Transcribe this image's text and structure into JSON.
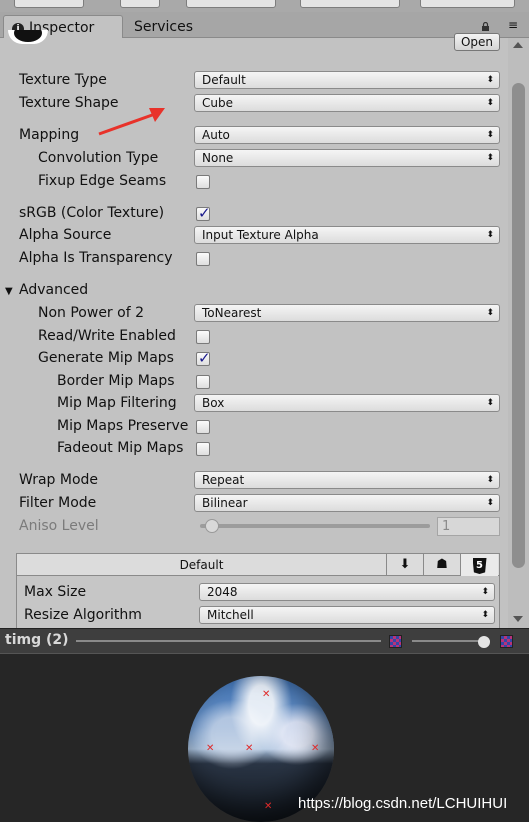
{
  "tabs": {
    "inspector": "Inspector",
    "services": "Services"
  },
  "header": {
    "open_button": "Open"
  },
  "properties": {
    "texture_type": {
      "label": "Texture Type",
      "value": "Default"
    },
    "texture_shape": {
      "label": "Texture Shape",
      "value": "Cube"
    },
    "mapping": {
      "label": "Mapping",
      "value": "Auto"
    },
    "convolution_type": {
      "label": "Convolution Type",
      "value": "None"
    },
    "fixup_edge_seams": {
      "label": "Fixup Edge Seams",
      "checked": false
    },
    "srgb": {
      "label": "sRGB (Color Texture)",
      "checked": true
    },
    "alpha_source": {
      "label": "Alpha Source",
      "value": "Input Texture Alpha"
    },
    "alpha_is_transparency": {
      "label": "Alpha Is Transparency",
      "checked": false
    },
    "advanced": {
      "label": "Advanced",
      "expanded": true
    },
    "non_power_of_2": {
      "label": "Non Power of 2",
      "value": "ToNearest"
    },
    "read_write": {
      "label": "Read/Write Enabled",
      "checked": false
    },
    "generate_mip_maps": {
      "label": "Generate Mip Maps",
      "checked": true
    },
    "border_mip_maps": {
      "label": "Border Mip Maps",
      "checked": false
    },
    "mip_map_filtering": {
      "label": "Mip Map Filtering",
      "value": "Box"
    },
    "mip_maps_preserve": {
      "label": "Mip Maps Preserve",
      "checked": false
    },
    "fadeout_mip_maps": {
      "label": "Fadeout Mip Maps",
      "checked": false
    },
    "wrap_mode": {
      "label": "Wrap Mode",
      "value": "Repeat"
    },
    "filter_mode": {
      "label": "Filter Mode",
      "value": "Bilinear"
    },
    "aniso_level": {
      "label": "Aniso Level",
      "value": "1",
      "slider_fraction": 0.0
    }
  },
  "platform": {
    "default_tab": "Default",
    "icons": [
      "download-icon",
      "android-icon",
      "html5-icon"
    ],
    "html5_glyph": "5",
    "max_size": {
      "label": "Max Size",
      "value": "2048"
    },
    "resize_algorithm": {
      "label": "Resize Algorithm",
      "value": "Mitchell"
    }
  },
  "preview": {
    "title": "timg (2)"
  },
  "watermark": "https://blog.csdn.net/LCHUIHUI",
  "colors": {
    "annotation_arrow": "#e8322a",
    "checkmark": "#1a1a8c",
    "preview_bg": "#262626"
  },
  "glyphs": {
    "dropdown_arrow": "⬍",
    "check": "✓",
    "fold_open": "▼",
    "info": "i",
    "download": "⬇",
    "android": "☗",
    "lock": "🔒",
    "menu": "≡"
  }
}
